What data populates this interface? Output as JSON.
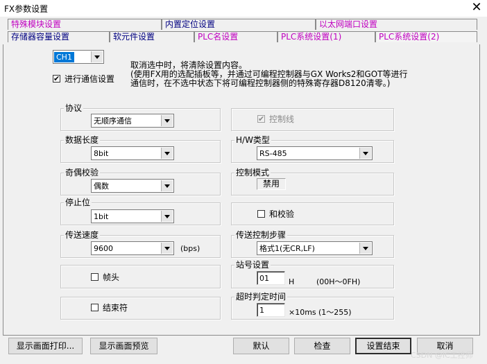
{
  "window": {
    "title": "FX参数设置",
    "close_glyph": "✕"
  },
  "tabs": {
    "row1": [
      "特殊模块设置",
      "内置定位设置",
      "以太网端口设置"
    ],
    "row2": [
      "存储器容量设置",
      "软元件设置",
      "PLC名设置",
      "PLC系统设置(1)",
      "PLC系统设置(2)"
    ]
  },
  "channel": {
    "value": "CH1"
  },
  "comm_setting": {
    "label": "进行通信设置",
    "checked": true,
    "check_glyph": "✔"
  },
  "notice": {
    "line1": "取消选中时，将清除设置内容。",
    "line2": "(使用FX用的选配插板等，并通过可编程控制器与GX Works2和GOT等进行",
    "line3": "通信时，在不选中状态下将可编程控制器侧的特殊寄存器D8120清零。)"
  },
  "left": {
    "protocol": {
      "label": "协议",
      "value": "无顺序通信"
    },
    "data_length": {
      "label": "数据长度",
      "value": "8bit"
    },
    "parity": {
      "label": "奇偶校验",
      "value": "偶数"
    },
    "stop_bit": {
      "label": "停止位",
      "value": "1bit"
    },
    "baud_rate": {
      "label": "传送速度",
      "value": "9600",
      "unit": "(bps)"
    },
    "header": {
      "label": "帧头",
      "checked": false
    },
    "terminator": {
      "label": "结束符",
      "checked": false
    }
  },
  "right": {
    "control_line": {
      "label": "控制线",
      "checked": true,
      "disabled": true
    },
    "hw_type": {
      "label": "H/W类型",
      "value": "RS-485"
    },
    "control_mode": {
      "label": "控制模式",
      "value": "禁用"
    },
    "checksum": {
      "label": "和校验",
      "checked": false
    },
    "transfer_procedure": {
      "label": "传送控制步骤",
      "value": "格式1(无CR,LF)"
    },
    "station": {
      "label": "站号设置",
      "value": "01",
      "unit": "H",
      "range": "(00H～0FH)"
    },
    "timeout": {
      "label": "超时判定时间",
      "value": "1",
      "unit": "×10ms",
      "range": "(1～255)"
    }
  },
  "buttons": {
    "print": "显示画面打印...",
    "preview": "显示画面预览",
    "default": "默认",
    "check": "检查",
    "finish": "设置结束",
    "cancel": "取消"
  },
  "watermark": "CSDN @IC工控师"
}
